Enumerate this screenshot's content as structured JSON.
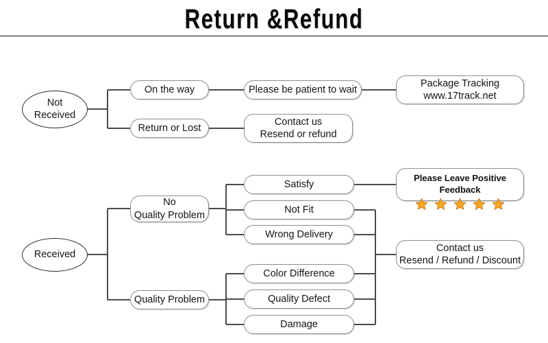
{
  "title": "Return &Refund",
  "nodes": {
    "not_received": {
      "line1": "Not",
      "line2": "Received"
    },
    "on_the_way": {
      "line1": "On the way"
    },
    "return_or_lost": {
      "line1": "Return or Lost"
    },
    "be_patient": {
      "line1": "Please be patient to wait"
    },
    "package_tracking": {
      "line1": "Package Tracking",
      "line2": "www.17track.net"
    },
    "contact_resend_refund": {
      "line1": "Contact us",
      "line2": "Resend or refund"
    },
    "received": {
      "line1": "Received"
    },
    "no_quality_problem": {
      "line1": "No",
      "line2": "Quality Problem"
    },
    "quality_problem": {
      "line1": "Quality Problem"
    },
    "satisfy": {
      "line1": "Satisfy"
    },
    "not_fit": {
      "line1": "Not Fit"
    },
    "wrong_delivery": {
      "line1": "Wrong Delivery"
    },
    "color_difference": {
      "line1": "Color Difference"
    },
    "quality_defect": {
      "line1": "Quality Defect"
    },
    "damage": {
      "line1": "Damage"
    },
    "feedback": {
      "caption": "Please Leave Positive Feedback",
      "stars": 5
    },
    "contact_resend_refund_discount": {
      "line1": "Contact us",
      "line2": "Resend / Refund / Discount"
    }
  },
  "colors": {
    "star": "#F5A623",
    "star_outline": "#C47B12",
    "box_border": "#8d8d8d",
    "ellipse_border": "#2b2b2b",
    "connector": "#4a4a4a",
    "title": "#0a0a0a"
  }
}
